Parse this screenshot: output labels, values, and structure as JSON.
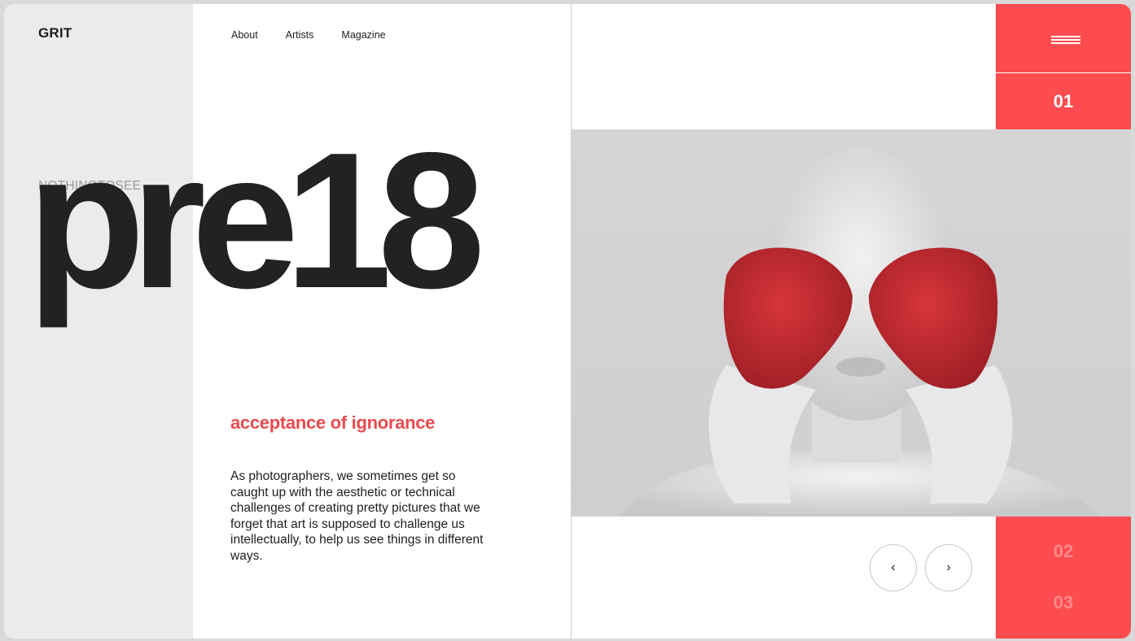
{
  "header": {
    "logo": "GRIT",
    "nav": [
      {
        "label": "About"
      },
      {
        "label": "Artists"
      },
      {
        "label": "Magazine"
      }
    ]
  },
  "hero": {
    "kicker": "NOTHINGTOSEE",
    "title": "pre18",
    "subtitle": "acceptance of ignorance",
    "body": "As photographers, we sometimes get so caught up with the aesthetic or technical challenges of creating pretty pictures that we forget that art is supposed to challenge us intellectually, to help us see things in different ways."
  },
  "slider": {
    "current": "01",
    "others": [
      "02",
      "03"
    ],
    "prev_icon": "‹",
    "next_icon": "›"
  },
  "colors": {
    "accent": "#fd4c4f",
    "subtitle": "#e84a4f",
    "text": "#1e1e20",
    "panel": "#ebebeb"
  },
  "icons": {
    "menu": "hamburger-menu-icon",
    "prev": "chevron-left-icon",
    "next": "chevron-right-icon"
  }
}
